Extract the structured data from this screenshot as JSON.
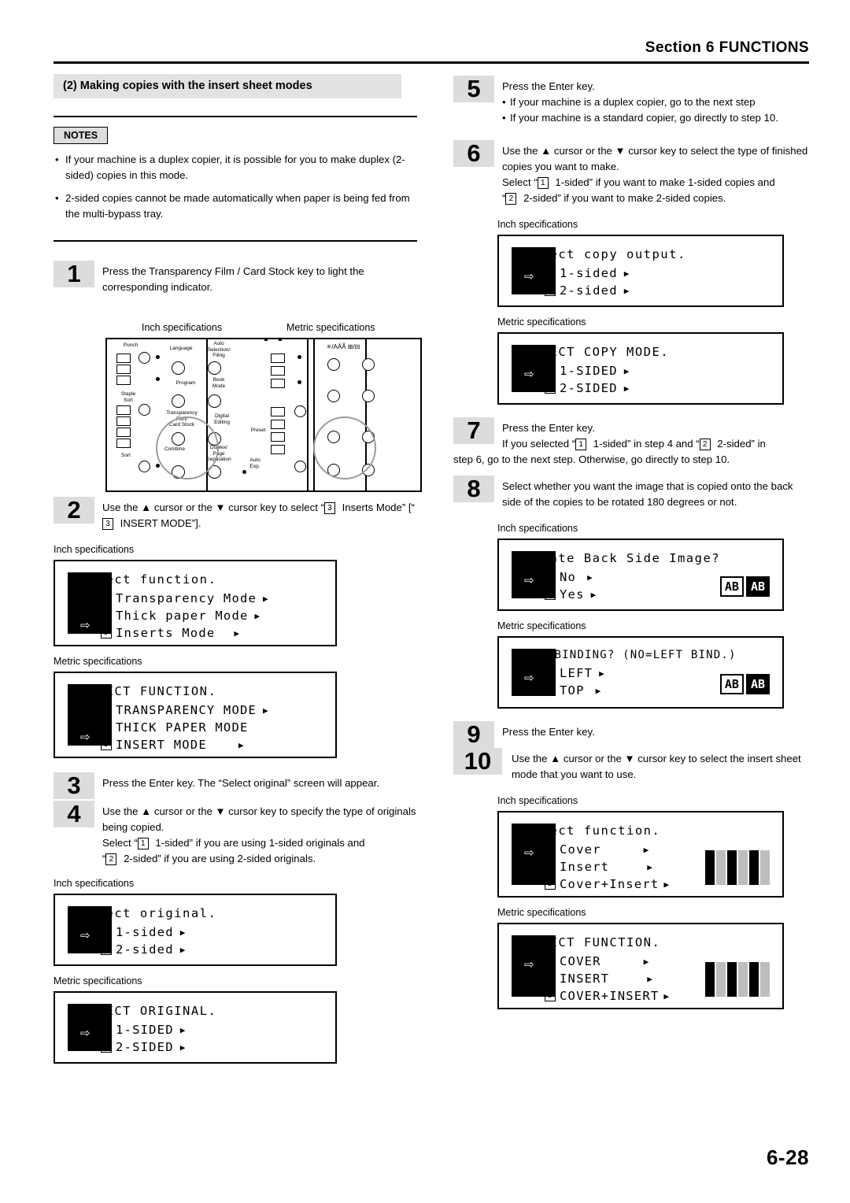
{
  "header": {
    "section": "Section 6",
    "title": "FUNCTIONS"
  },
  "page_number": "6-28",
  "section_heading": "(2) Making copies with the insert sheet modes",
  "notes": {
    "label": "NOTES",
    "items": [
      "If your machine is a duplex copier, it is possible for you to make duplex (2-sided) copies in this mode.",
      "2-sided copies cannot be made automatically when paper is being fed from the multi-bypass tray."
    ]
  },
  "captions": {
    "inch": "Inch specifications",
    "metric": "Metric specifications"
  },
  "steps": {
    "s1": {
      "num": "1",
      "text": "Press the Transparency Film / Card Stock key to light the corresponding indicator."
    },
    "s2": {
      "num": "2",
      "text_a": "Use the ",
      "text_b": " cursor or the ",
      "text_c": " cursor key to select “",
      "num_box": "3",
      "text_d": " Inserts Mode” [“",
      "num_box2": "3",
      "text_e": " INSERT MODE”]."
    },
    "s3": {
      "num": "3",
      "text": "Press the Enter key. The “Select original” screen will appear."
    },
    "s4": {
      "num": "4",
      "line1a": "Use the ",
      "line1b": " cursor or the ",
      "line1c": " cursor key to specify the type of originals being copied.",
      "line2a": "Select “",
      "line2b": " 1-sided” if you are using 1-sided originals and",
      "line3a": "“",
      "line3b": " 2-sided” if you are using 2-sided originals."
    },
    "s5": {
      "num": "5",
      "line1": "Press the Enter key.",
      "b1": "If your machine is a duplex copier, go to the next step",
      "b2": "If your machine is a standard copier, go directly to step 10."
    },
    "s6": {
      "num": "6",
      "line1a": "Use the ",
      "line1b": " cursor or the ",
      "line1c": " cursor key to select the type of finished copies you want to make.",
      "line2a": "Select “",
      "line2b": " 1-sided” if you want to make 1-sided copies and",
      "line3a": "“",
      "line3b": " 2-sided” if you want to make 2-sided copies."
    },
    "s7": {
      "num": "7",
      "line1": "Press the Enter key.",
      "line2a": "If you selected “",
      "line2b": " 1-sided” in step 4 and “",
      "line2c": " 2-sided” in",
      "line3": "step 6, go to the next step. Otherwise, go directly to step 10."
    },
    "s8": {
      "num": "8",
      "text": "Select whether you want the image that is copied onto the back side of the copies to be rotated 180 degrees or not."
    },
    "s9": {
      "num": "9",
      "text": "Press the Enter key."
    },
    "s10": {
      "num": "10",
      "line1a": "Use the ",
      "line1b": " cursor or the ",
      "line1c": " cursor key to select the insert sheet mode that you want to use."
    }
  },
  "lcd": {
    "select_function_inch": {
      "title": "Select function.",
      "rows": [
        {
          "n": "1",
          "label": "Transparency Mode",
          "tri": "▶",
          "sel": false
        },
        {
          "n": "2",
          "label": "Thick paper Mode",
          "tri": "▶",
          "sel": false
        },
        {
          "n": "3",
          "label": "Inserts Mode",
          "tri": "▶",
          "sel": true
        }
      ]
    },
    "select_function_metric": {
      "title": "SELECT FUNCTION.",
      "rows": [
        {
          "n": "1",
          "label": "TRANSPARENCY MODE",
          "tri": "▶",
          "sel": false
        },
        {
          "n": "2",
          "label": "THICK PAPER MODE",
          "tri": "▶",
          "sel": false
        },
        {
          "n": "3",
          "label": "INSERT MODE",
          "tri": "▶",
          "sel": true
        }
      ]
    },
    "select_original_inch": {
      "title": "Select original.",
      "rows": [
        {
          "n": "1",
          "label": "1-sided",
          "tri": "▶",
          "sel": true
        },
        {
          "n": "2",
          "label": "2-sided",
          "tri": "▶",
          "sel": false
        }
      ]
    },
    "select_original_metric": {
      "title": "SELECT ORIGINAL.",
      "rows": [
        {
          "n": "1",
          "label": "1-SIDED",
          "tri": "▶",
          "sel": true
        },
        {
          "n": "2",
          "label": "2-SIDED",
          "tri": "▶",
          "sel": false
        }
      ]
    },
    "select_copy_output_inch": {
      "title": "Select copy output.",
      "rows": [
        {
          "n": "1",
          "label": "1-sided",
          "tri": "▶",
          "sel": true
        },
        {
          "n": "2",
          "label": "2-sided",
          "tri": "▶",
          "sel": false
        }
      ]
    },
    "select_copy_mode_metric": {
      "title": "SELECT COPY MODE.",
      "rows": [
        {
          "n": "1",
          "label": "1-SIDED",
          "tri": "▶",
          "sel": true
        },
        {
          "n": "2",
          "label": "2-SIDED",
          "tri": "▶",
          "sel": false
        }
      ]
    },
    "rotate_back_inch": {
      "title": "Rotate Back Side Image?",
      "rows": [
        {
          "n": "1",
          "label": "No",
          "tri": "▶",
          "sel": true
        },
        {
          "n": "2",
          "label": "Yes",
          "tri": "▶",
          "sel": false
        }
      ],
      "icon": {
        "left": "AB",
        "right": "AB"
      }
    },
    "top_binding_metric": {
      "title": "TOP BINDING? (NO=LEFT BIND.)",
      "rows": [
        {
          "n": "1",
          "label": "LEFT",
          "tri": "▶",
          "sel": true
        },
        {
          "n": "2",
          "label": "TOP",
          "tri": "▶",
          "sel": false
        }
      ],
      "icon": {
        "left": "AB",
        "right": "AB"
      }
    },
    "select_function2_inch": {
      "title": "Select function.",
      "rows": [
        {
          "n": "1",
          "label": "Cover",
          "tri": "▶",
          "sel": true
        },
        {
          "n": "2",
          "label": "Insert",
          "tri": "▶",
          "sel": false
        },
        {
          "n": "3",
          "label": "Cover+Insert",
          "tri": "▶",
          "sel": false
        }
      ]
    },
    "select_function2_metric": {
      "title": "SELECT FUNCTION.",
      "rows": [
        {
          "n": "1",
          "label": "COVER",
          "tri": "▶",
          "sel": true
        },
        {
          "n": "2",
          "label": "INSERT",
          "tri": "▶",
          "sel": false
        },
        {
          "n": "3",
          "label": "COVER+INSERT",
          "tri": "▶",
          "sel": false
        }
      ]
    }
  },
  "panel": {
    "labels_inch": [
      "Punch",
      "Auto Selection/ Filing",
      "Language",
      "Program",
      "Book Mode",
      "Staple Sort",
      "Transparency Film/ Card Stock",
      "Digital Editing",
      "Preset",
      "Duplex/ Page Separation",
      "Sort",
      "Auto Exposure"
    ]
  }
}
